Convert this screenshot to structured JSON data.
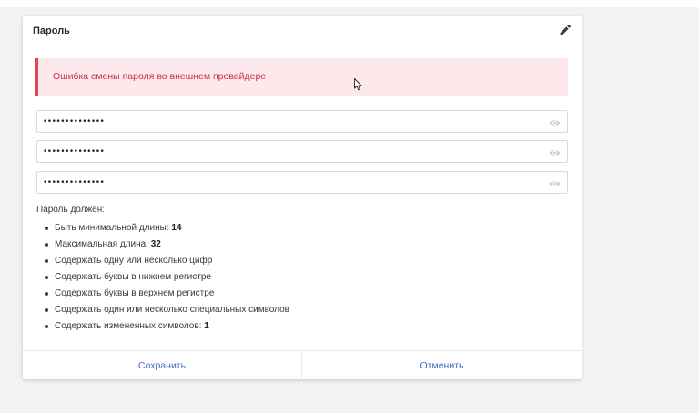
{
  "card": {
    "title": "Пароль",
    "edit_icon": "pencil-icon"
  },
  "alert": {
    "message": "Ошибка смены пароля во внешнем провайдере",
    "color": "#c93046",
    "border_color": "#e0435a",
    "background": "#fde9ec"
  },
  "fields": [
    {
      "value": "••••••••••••••",
      "icon": "eye-icon"
    },
    {
      "value": "••••••••••••••",
      "icon": "eye-icon"
    },
    {
      "value": "••••••••••••••",
      "icon": "eye-icon"
    }
  ],
  "requirements": {
    "title": "Пароль должен:",
    "items": [
      {
        "text": "Быть минимальной длины: ",
        "value": "14"
      },
      {
        "text": "Максимальная длина: ",
        "value": "32"
      },
      {
        "text": "Содержать одну или несколько цифр",
        "value": ""
      },
      {
        "text": "Содержать буквы в нижнем регистре",
        "value": ""
      },
      {
        "text": "Содержать буквы в верхнем регистре",
        "value": ""
      },
      {
        "text": "Содержать один или несколько специальных символов",
        "value": ""
      },
      {
        "text": "Содержать измененных символов: ",
        "value": "1"
      }
    ]
  },
  "footer": {
    "save_label": "Сохранить",
    "cancel_label": "Отменить",
    "link_color": "#3d6fc4"
  }
}
